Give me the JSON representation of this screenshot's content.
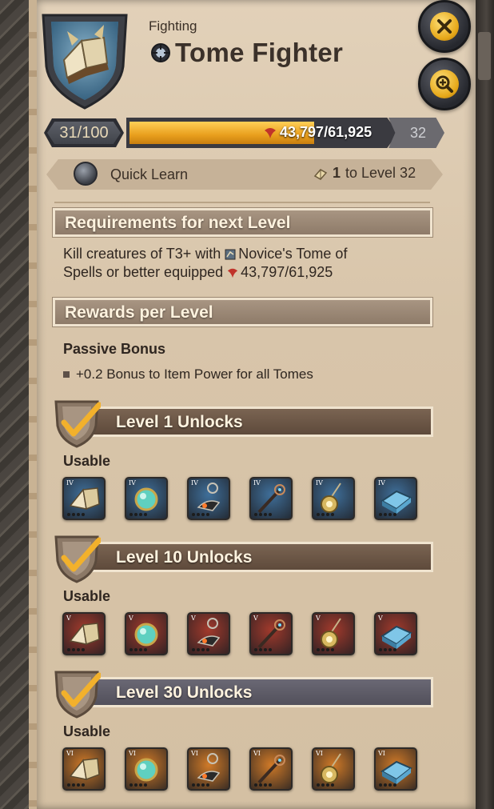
{
  "header": {
    "category": "Fighting",
    "title": "Tome Fighter"
  },
  "progress": {
    "current_level": "31/100",
    "fame_current": "43,797",
    "fame_sep": "/61,925",
    "fame_fraction": 0.7073,
    "next_level": "32"
  },
  "quick_learn": {
    "label": "Quick Learn",
    "tome_count": "1",
    "tome_target": "to Level 32"
  },
  "requirements": {
    "header": "Requirements for next Level",
    "line1_prefix": "Kill creatures of T3+ with",
    "item_name": "Novice's Tome of",
    "line2_prefix": "Spells or better equipped",
    "fame": "43,797/61,925"
  },
  "rewards": {
    "header": "Rewards per Level",
    "passive_title": "Passive Bonus",
    "passive_item": "+0.2 Bonus to Item Power for all Tomes"
  },
  "unlocks": [
    {
      "title": "Level 1 Unlocks",
      "usable": "Usable",
      "tier": "IV",
      "bg": "#3f6f9a"
    },
    {
      "title": "Level 10 Unlocks",
      "usable": "Usable",
      "tier": "V",
      "bg": "#a23a2c"
    },
    {
      "title": "Level 30 Unlocks",
      "usable": "Usable",
      "tier": "VI",
      "bg": "#d07a28"
    }
  ],
  "colors": {
    "accent_gold": "#f2b12c",
    "bar_fill": "#e99f1d",
    "header_bg": "#8e7b69"
  }
}
